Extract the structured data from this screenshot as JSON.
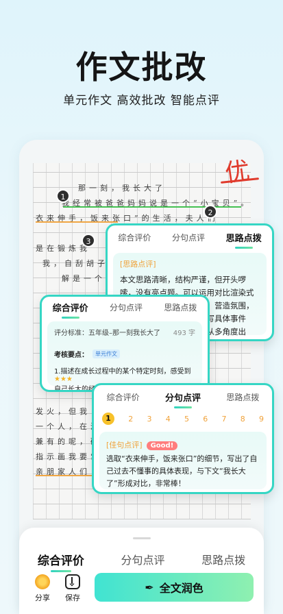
{
  "hero": {
    "title": "作文批改",
    "subtitle": "单元作文 高效批改 智能点评"
  },
  "essay": {
    "grade": "优",
    "lines": [
      "那一刻，我长大了",
      "我经常被爸爸妈妈说是一个“小宝贝”。",
      "衣来伸手，饭来张口”的生活，夫人们",
      "是在锻炼我",
      "我，自刮胡子",
      "解是一个",
      "发火，但我",
      "一个人，在演讲",
      "兼有的呢，碗",
      "指示画我要常",
      "亲朋家人们"
    ],
    "badges": [
      "1",
      "2",
      "3"
    ]
  },
  "card_sentence_review_top": {
    "tabs": [
      "综合评价",
      "分句点评",
      "思路点拨"
    ],
    "active_tab": "思路点拨",
    "section_tag": "[思路点评]",
    "text": "本文思路清晰，结构严谨，但开头啰嗦，没有亮点题。可以运用对比渲染式开头，用精练的语言开篇，营造氛围，增强文章的吸引力。在描写具体事件时，细节描写较少，可以从多角度出发，运用动作、语言、外貌、神态等进行具体描写，使文章更生动可爱。"
  },
  "card_overall": {
    "tabs": [
      "综合评价",
      "分句点评",
      "思路点拨"
    ],
    "active_tab": "综合评价",
    "standard_label": "评分标准：五年级–那一刻我长大了",
    "word_count": "493 字",
    "key_points_label": "考核要点：",
    "key_points_tag": "单元作文",
    "point_1": "1.描述在成长过程中的某个特定时刻，感受到",
    "point_1_cont": "自己长大的经历。",
    "stars": "★★★"
  },
  "card_sentence": {
    "tabs": [
      "综合评价",
      "分句点评",
      "思路点拨"
    ],
    "active_tab": "分句点评",
    "numbers": [
      "1",
      "2",
      "3",
      "4",
      "5",
      "6",
      "7",
      "8",
      "9"
    ],
    "active_number": "1",
    "section_tag": "[佳句点评]",
    "badge": "Good!",
    "text": "选取“衣来伸手，饭来张口”的细节，写出了自己过去不懂事的具体表现，与下文“我长大了”形成对比，非常棒！"
  },
  "bottom_sheet": {
    "tabs": [
      "综合评价",
      "分句点评",
      "思路点拨"
    ],
    "active_tab": "综合评价",
    "share_label": "分享",
    "save_label": "保存",
    "polish_label": "全文润色"
  },
  "colors": {
    "accent": "#35d6c4",
    "grade_red": "#e03a2c",
    "tag_orange": "#f0a23a"
  }
}
